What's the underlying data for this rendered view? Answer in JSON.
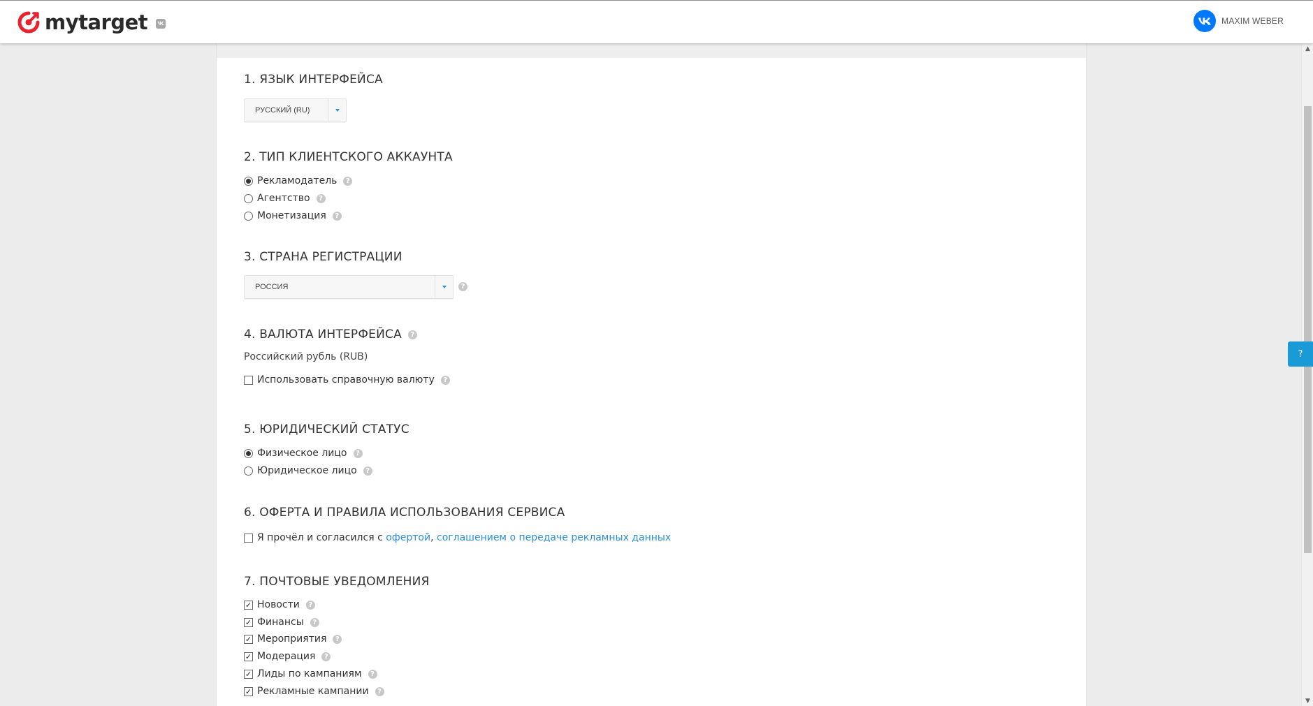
{
  "header": {
    "logo_text": "mytarget",
    "user_name": "MAXIM WEBER"
  },
  "colors": {
    "brand_red": "#e8232f",
    "vk_blue": "#0077ff",
    "link_blue": "#2a8fd6",
    "help_tab_blue": "#1a9ad6"
  },
  "icons": {
    "logo": "mytarget-logo-icon",
    "vk_badge": "vk-icon",
    "avatar": "vk-avatar-icon",
    "help": "question-icon",
    "dropdown": "chevron-down-icon"
  },
  "sections": {
    "language": {
      "title": "1. ЯЗЫК ИНТЕРФЕЙСА",
      "selected": "РУССКИЙ (RU)"
    },
    "account_type": {
      "title": "2. ТИП КЛИЕНТСКОГО АККАУНТА",
      "options": [
        {
          "label": "Рекламодатель",
          "checked": true
        },
        {
          "label": "Агентство",
          "checked": false
        },
        {
          "label": "Монетизация",
          "checked": false
        }
      ]
    },
    "country": {
      "title": "3. СТРАНА РЕГИСТРАЦИИ",
      "selected": "РОССИЯ"
    },
    "currency": {
      "title": "4. ВАЛЮТА ИНТЕРФЕЙСА",
      "value": "Российский рубль (RUB)",
      "checkbox_label": "Использовать справочную валюту",
      "checkbox_checked": false
    },
    "legal_status": {
      "title": "5. ЮРИДИЧЕСКИЙ СТАТУС",
      "options": [
        {
          "label": "Физическое лицо",
          "checked": true
        },
        {
          "label": "Юридическое лицо",
          "checked": false
        }
      ]
    },
    "offer": {
      "title": "6. ОФЕРТА И ПРАВИЛА ИСПОЛЬЗОВАНИЯ СЕРВИСА",
      "text_prefix": "Я прочёл и согласился с ",
      "link_offer": "офертой",
      "separator": ", ",
      "link_agreement": "соглашением о передаче рекламных данных",
      "checked": false
    },
    "notifications": {
      "title": "7. ПОЧТОВЫЕ УВЕДОМЛЕНИЯ",
      "items": [
        {
          "label": "Новости",
          "checked": true
        },
        {
          "label": "Финансы",
          "checked": true
        },
        {
          "label": "Мероприятия",
          "checked": true
        },
        {
          "label": "Модерация",
          "checked": true
        },
        {
          "label": "Лиды по кампаниям",
          "checked": true
        },
        {
          "label": "Рекламные кампании",
          "checked": true
        }
      ]
    }
  },
  "help_tab": {
    "label": "?"
  },
  "help_mark": "?",
  "check_mark": "✓"
}
